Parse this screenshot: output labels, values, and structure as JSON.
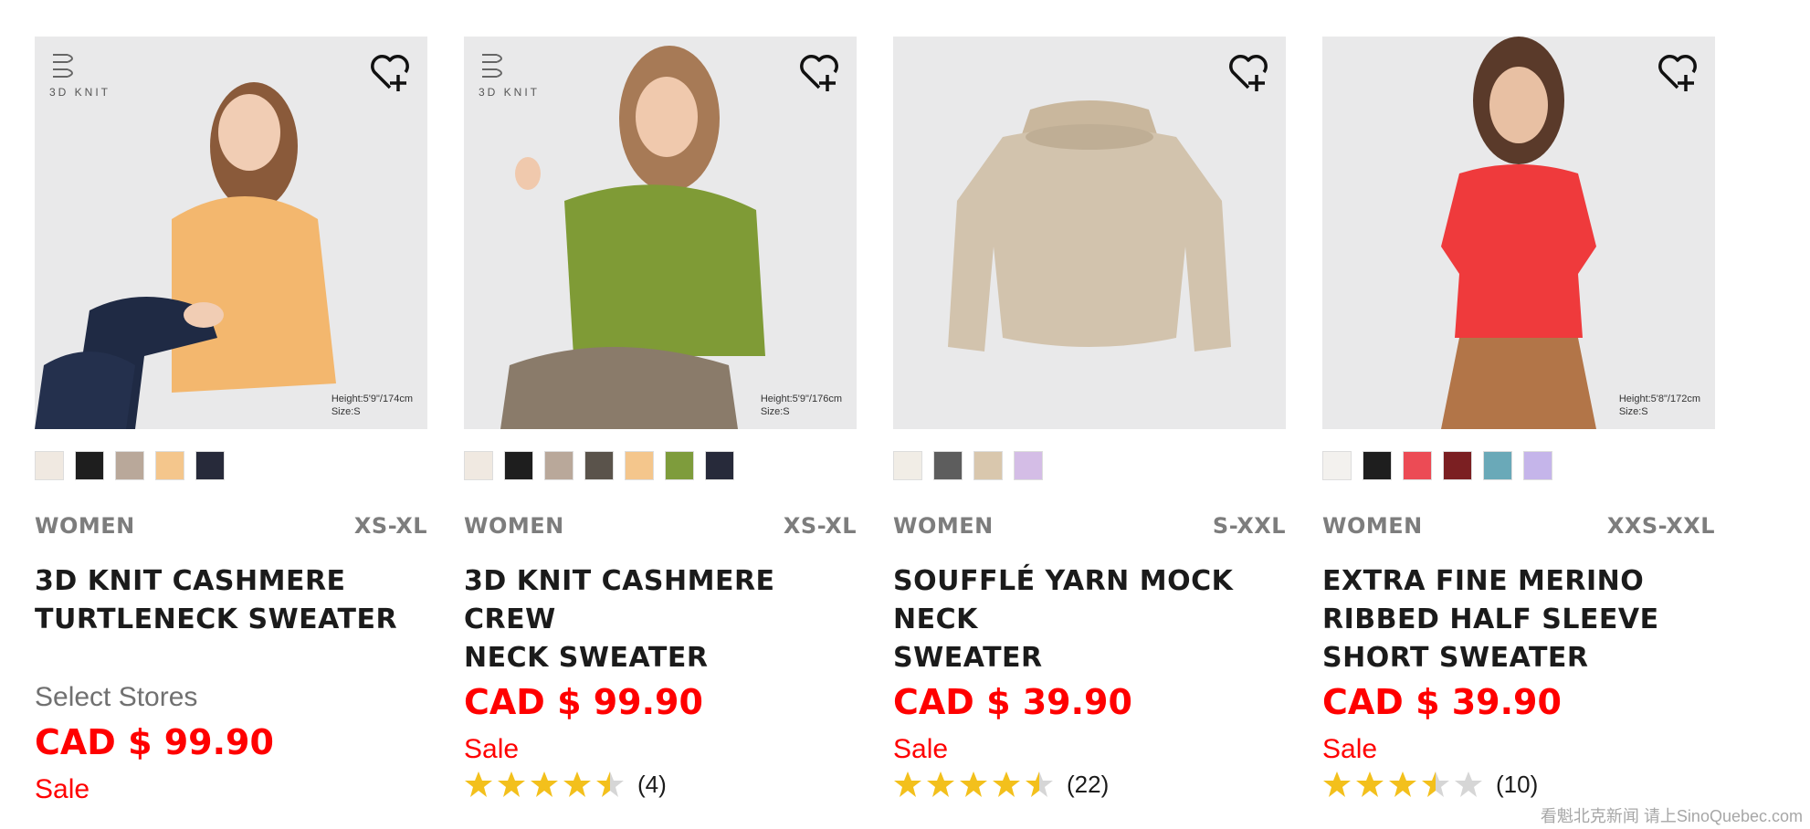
{
  "products": [
    {
      "badge": "3D KNIT",
      "model_note": [
        "Height:5'9\"/174cm",
        "Size:S"
      ],
      "swatches": [
        "#f0e9e1",
        "#1e1e1e",
        "#b9a89a",
        "#f4c68c",
        "#272a3a"
      ],
      "category": "WOMEN",
      "size_range": "XS-XL",
      "name_lines": [
        "3D KNIT CASHMERE",
        "TURTLENECK SWEATER"
      ],
      "stores_note": "Select Stores",
      "price": "CAD $ 99.90",
      "sale": "Sale"
    },
    {
      "badge": "3D KNIT",
      "model_note": [
        "Height:5'9\"/176cm",
        "Size:S"
      ],
      "swatches": [
        "#f0e9e1",
        "#1e1e1e",
        "#b9a89a",
        "#5a534b",
        "#f4c68c",
        "#7e9c3c",
        "#272a3a"
      ],
      "category": "WOMEN",
      "size_range": "XS-XL",
      "name_lines": [
        "3D KNIT CASHMERE CREW",
        "NECK SWEATER"
      ],
      "price": "CAD $ 99.90",
      "sale": "Sale",
      "rating": 4.5,
      "review_count": "(4)"
    },
    {
      "swatches": [
        "#f1ede6",
        "#5d5d5d",
        "#d9c7ad",
        "#d4bde6"
      ],
      "category": "WOMEN",
      "size_range": "S-XXL",
      "name_lines": [
        "SOUFFLÉ YARN MOCK NECK",
        "SWEATER"
      ],
      "price": "CAD $ 39.90",
      "sale": "Sale",
      "rating": 4.5,
      "review_count": "(22)"
    },
    {
      "model_note": [
        "Height:5'8\"/172cm",
        "Size:S"
      ],
      "swatches": [
        "#f3f1ee",
        "#1e1e1e",
        "#ec4b55",
        "#7b1f22",
        "#6aa9b8",
        "#c5b5ea"
      ],
      "category": "WOMEN",
      "size_range": "XXS-XXL",
      "name_lines": [
        "EXTRA FINE MERINO",
        "RIBBED HALF SLEEVE",
        "SHORT SWEATER"
      ],
      "price": "CAD $ 39.90",
      "sale": "Sale",
      "rating": 3.5,
      "review_count": "(10)"
    }
  ],
  "colors": {
    "price_red": "#ff0000",
    "star_gold": "#f3c01c",
    "star_empty": "#d6d6d6"
  },
  "icons": {
    "wishlist": "heart-plus-icon",
    "badge": "3d-knit-logo-icon",
    "rating": "star-icon"
  },
  "watermark": "看魁北克新闻 请上SinoQuebec.com"
}
